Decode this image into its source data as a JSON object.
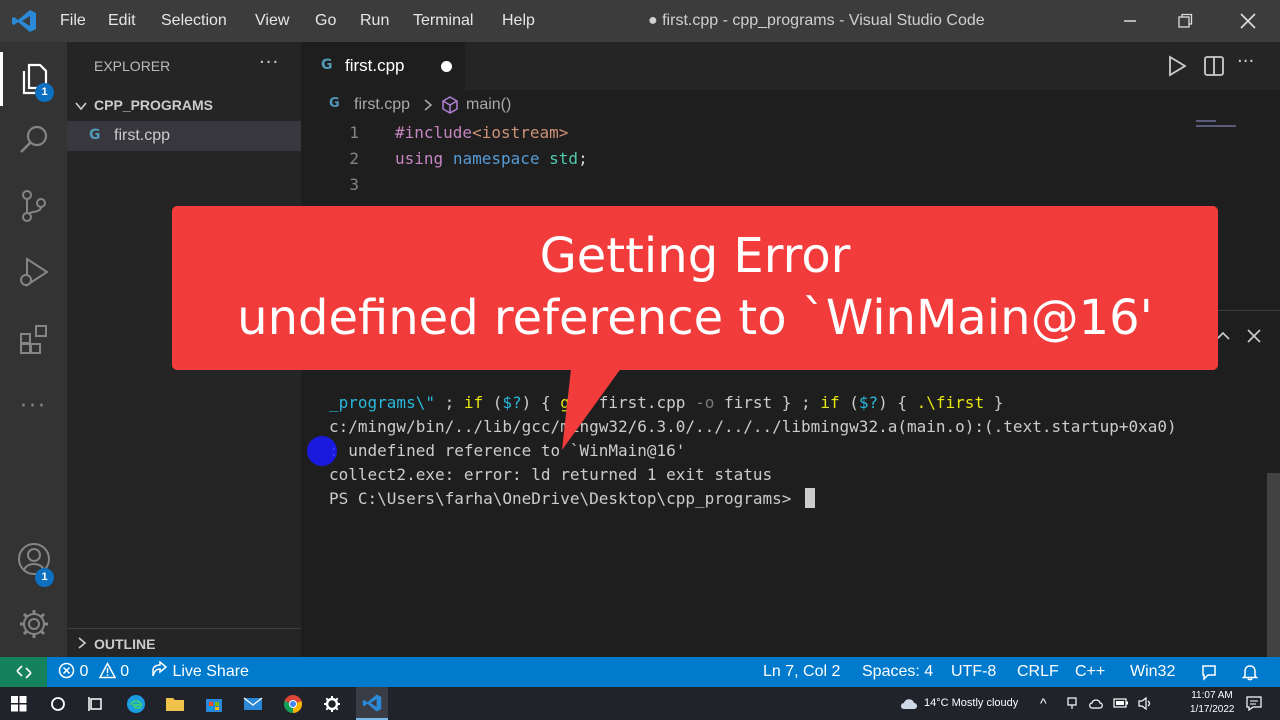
{
  "window": {
    "title": "● first.cpp - cpp_programs - Visual Studio Code",
    "menu": [
      "File",
      "Edit",
      "Selection",
      "View",
      "Go",
      "Run",
      "Terminal",
      "Help"
    ]
  },
  "activity_bar": {
    "explorer_badge": "1",
    "accounts_badge": "1"
  },
  "sidebar": {
    "title": "EXPLORER",
    "folder": "CPP_PROGRAMS",
    "files": [
      {
        "name": "first.cpp"
      }
    ],
    "outline": "OUTLINE"
  },
  "editor": {
    "tab_label": "first.cpp",
    "breadcrumb": {
      "file": "first.cpp",
      "symbol": "main()"
    },
    "lines": [
      {
        "num": "1",
        "parts": [
          {
            "t": "#include",
            "c": "kw-dir"
          },
          {
            "t": "<iostream>",
            "c": "kw-str"
          }
        ]
      },
      {
        "num": "2",
        "parts": [
          {
            "t": "using",
            "c": "kw-dir"
          },
          {
            "t": " ",
            "c": "kw-plain"
          },
          {
            "t": "namespace",
            "c": "kw-blue"
          },
          {
            "t": " ",
            "c": "kw-plain"
          },
          {
            "t": "std",
            "c": "kw-ns"
          },
          {
            "t": ";",
            "c": "kw-plain"
          }
        ]
      },
      {
        "num": "3",
        "parts": []
      }
    ]
  },
  "terminal": {
    "lines": [
      [
        {
          "t": "_programs\\\"",
          "c": "t-cyan"
        },
        {
          "t": " ; ",
          "c": ""
        },
        {
          "t": "if",
          "c": "t-yellow"
        },
        {
          "t": " (",
          "c": ""
        },
        {
          "t": "$?",
          "c": "t-cyan"
        },
        {
          "t": ") { ",
          "c": ""
        },
        {
          "t": "g++",
          "c": "t-yellow"
        },
        {
          "t": " first.cpp ",
          "c": ""
        },
        {
          "t": "-o",
          "c": "t-gray"
        },
        {
          "t": " first } ; ",
          "c": ""
        },
        {
          "t": "if",
          "c": "t-yellow"
        },
        {
          "t": " (",
          "c": ""
        },
        {
          "t": "$?",
          "c": "t-cyan"
        },
        {
          "t": ") { ",
          "c": ""
        },
        {
          "t": ".\\first",
          "c": "t-yellow"
        },
        {
          "t": " }",
          "c": ""
        }
      ],
      [
        {
          "t": "c:/mingw/bin/../lib/gcc/mingw32/6.3.0/../../../libmingw32.a(main.o):(.text.startup+0xa0)",
          "c": ""
        }
      ],
      [
        {
          "t": ": undefined reference to `WinMain@16'",
          "c": ""
        }
      ],
      [
        {
          "t": "collect2.exe: error: ld returned 1 exit status",
          "c": ""
        }
      ],
      [
        {
          "t": "PS C:\\Users\\farha\\OneDrive\\Desktop\\cpp_programs> ",
          "c": ""
        }
      ]
    ]
  },
  "callout": {
    "line1": "Getting Error",
    "line2": "undefined reference to `WinMain@16'"
  },
  "status_bar": {
    "errors": "0",
    "warnings": "0",
    "live_share": "Live Share",
    "position": "Ln 7, Col 2",
    "spaces": "Spaces: 4",
    "encoding": "UTF-8",
    "eol": "CRLF",
    "language": "C++",
    "platform": "Win32"
  },
  "taskbar": {
    "weather": "14°C  Mostly cloudy",
    "time": "11:07 AM",
    "date": "1/17/2022"
  },
  "colors": {
    "accent": "#007acc",
    "callout": "#f23b3b",
    "remote": "#16825d"
  }
}
